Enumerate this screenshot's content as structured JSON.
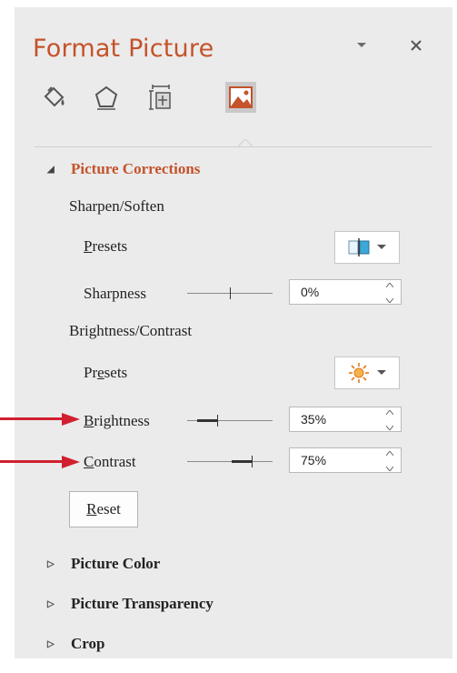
{
  "panel": {
    "title": "Format Picture",
    "tabs": [
      {
        "icon": "fill-bucket-icon"
      },
      {
        "icon": "pentagon-effects-icon"
      },
      {
        "icon": "size-properties-icon"
      },
      {
        "icon": "picture-icon",
        "active": true
      }
    ]
  },
  "sections": {
    "picture_corrections": {
      "label": "Picture Corrections",
      "sharpen": {
        "heading": "Sharpen/Soften",
        "presets_label": "Presets",
        "sharpness_label": "Sharpness",
        "sharpness_value": "0%",
        "sharpness_level": 0.5
      },
      "brightness_contrast": {
        "heading": "Brightness/Contrast",
        "presets_label": "Presets",
        "brightness_label": "Brightness",
        "brightness_value": "35%",
        "brightness_level": 0.35,
        "contrast_label": "Contrast",
        "contrast_value": "75%",
        "contrast_level": 0.75
      },
      "reset_label": "Reset"
    },
    "collapsed": [
      {
        "label": "Picture Color"
      },
      {
        "label": "Picture Transparency"
      },
      {
        "label": "Crop"
      }
    ]
  },
  "colors": {
    "accent": "#c4532b",
    "annotation_arrow": "#d0202f"
  }
}
